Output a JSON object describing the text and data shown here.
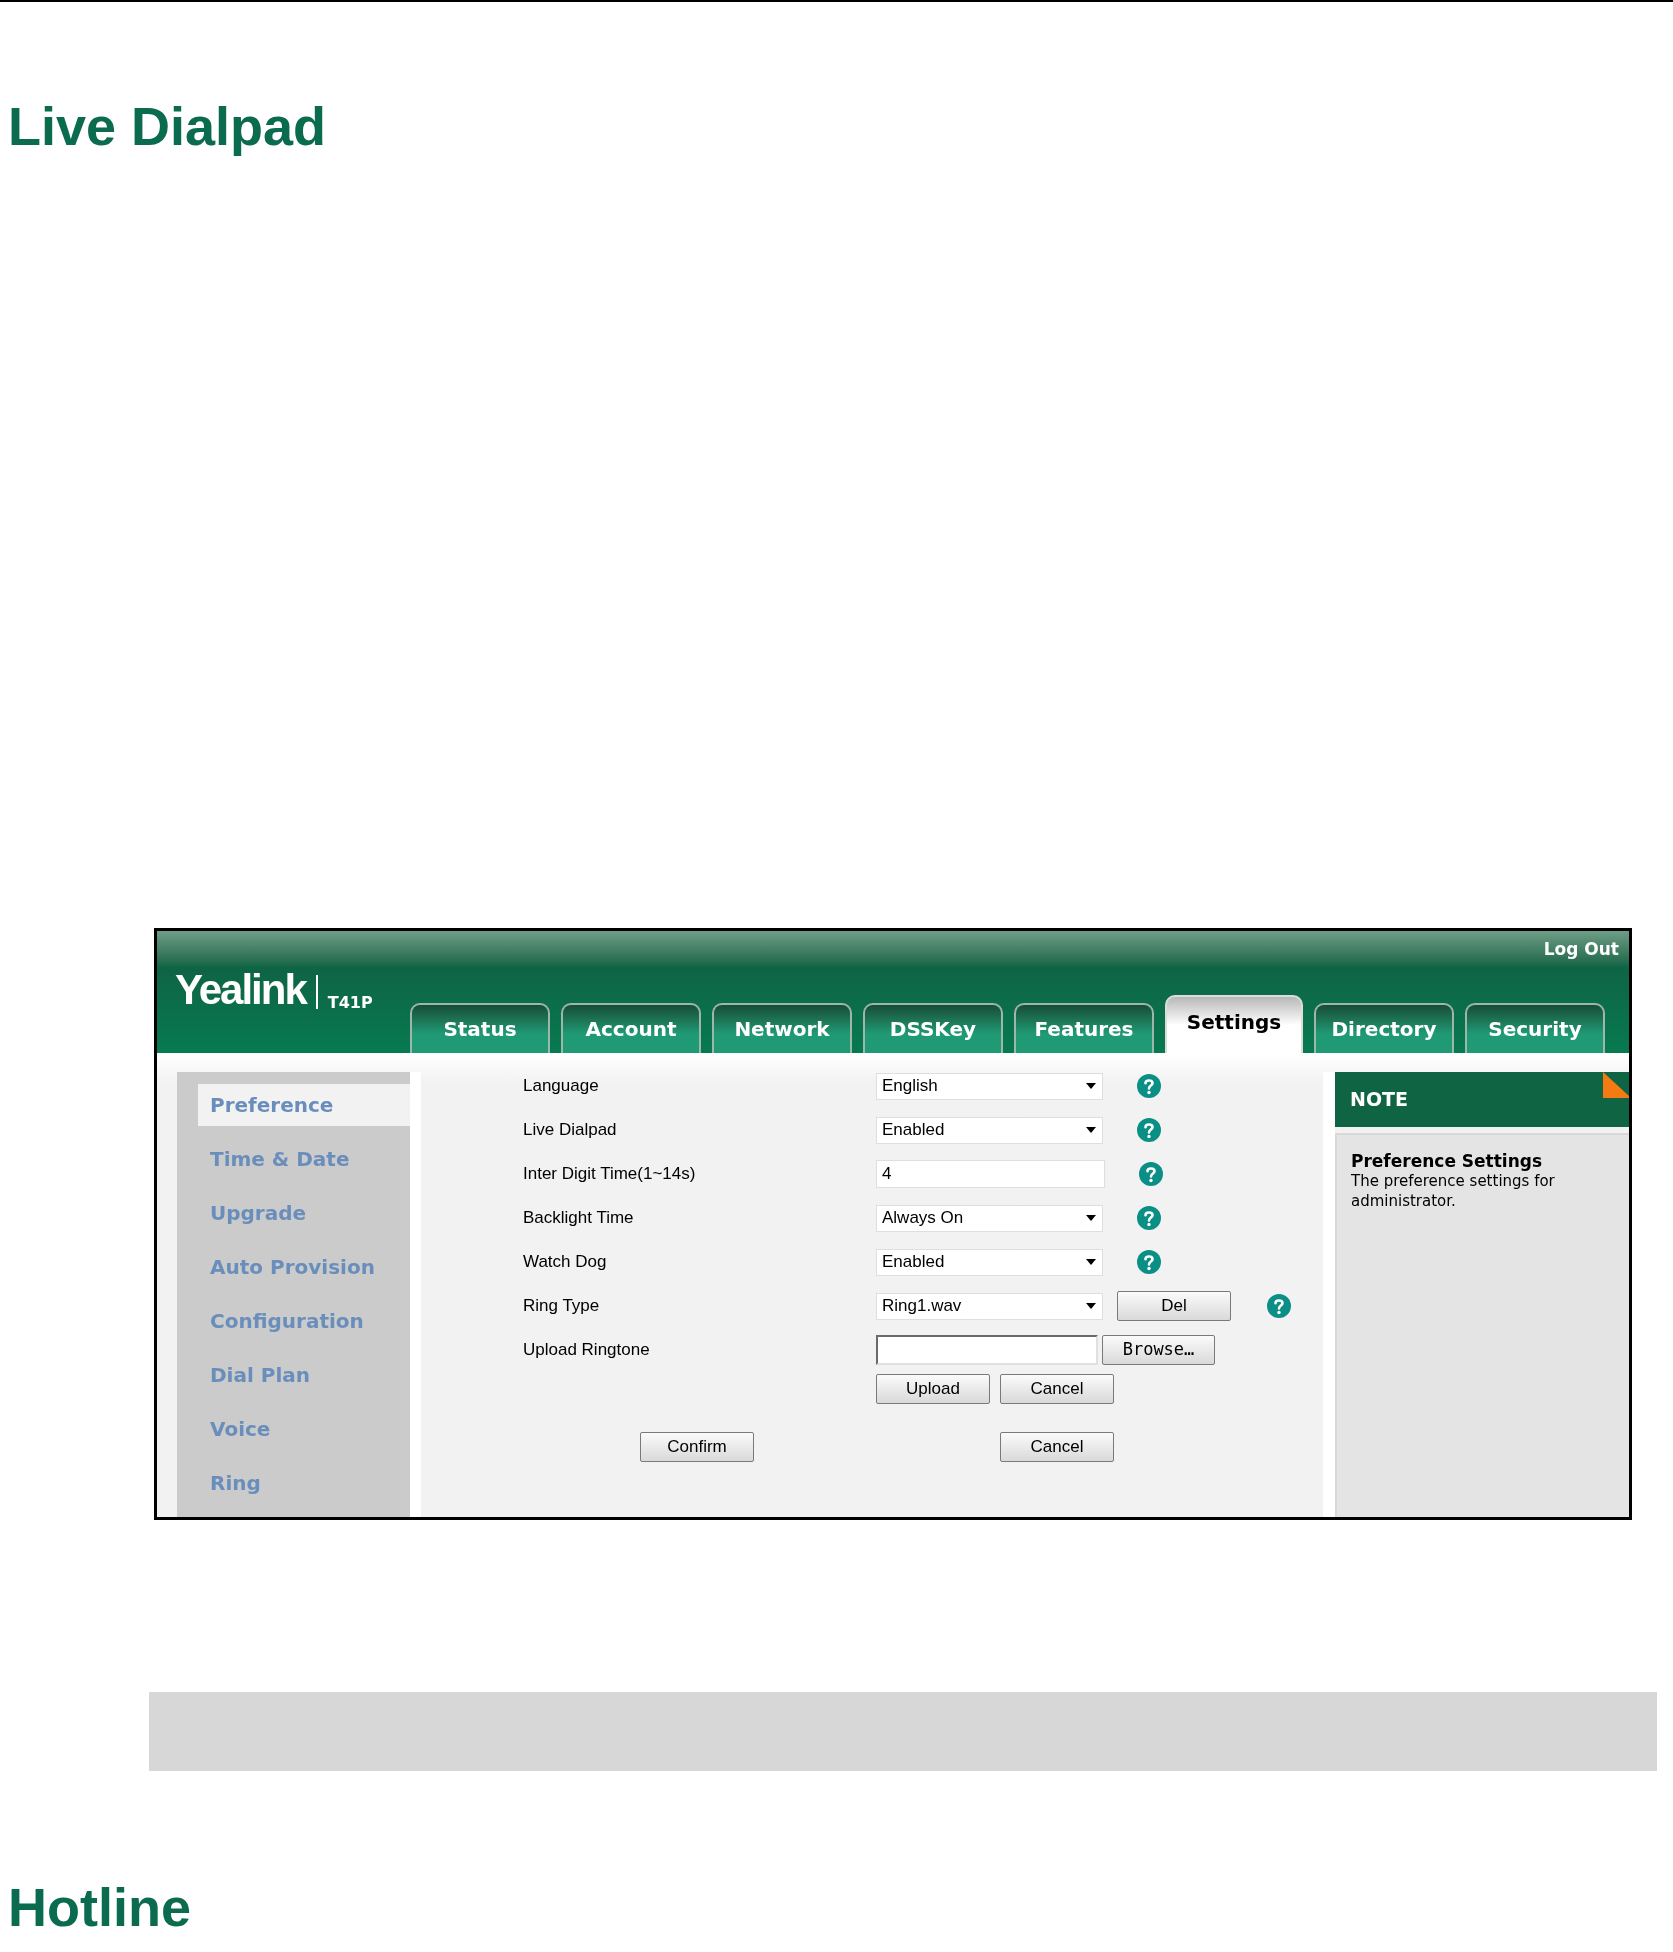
{
  "page_heading": "Live Dialpad",
  "app": {
    "logo": "Yealink",
    "model": "T41P",
    "logout": "Log Out",
    "tabs": [
      {
        "label": "Status",
        "selected": false
      },
      {
        "label": "Account",
        "selected": false
      },
      {
        "label": "Network",
        "selected": false
      },
      {
        "label": "DSSKey",
        "selected": false
      },
      {
        "label": "Features",
        "selected": false
      },
      {
        "label": "Settings",
        "selected": true
      },
      {
        "label": "Directory",
        "selected": false
      },
      {
        "label": "Security",
        "selected": false
      }
    ],
    "sidebar": [
      {
        "label": "Preference",
        "selected": true
      },
      {
        "label": "Time & Date",
        "selected": false
      },
      {
        "label": "Upgrade",
        "selected": false
      },
      {
        "label": "Auto Provision",
        "selected": false
      },
      {
        "label": "Configuration",
        "selected": false
      },
      {
        "label": "Dial Plan",
        "selected": false
      },
      {
        "label": "Voice",
        "selected": false
      },
      {
        "label": "Ring",
        "selected": false
      }
    ],
    "form": {
      "rows": [
        {
          "kind": "select",
          "label": "Language",
          "value": "English",
          "help": true
        },
        {
          "kind": "select",
          "label": "Live Dialpad",
          "value": "Enabled",
          "help": true
        },
        {
          "kind": "input",
          "label": "Inter Digit Time(1~14s)",
          "value": "4",
          "help": true
        },
        {
          "kind": "select",
          "label": "Backlight Time",
          "value": "Always On",
          "help": true
        },
        {
          "kind": "select",
          "label": "Watch Dog",
          "value": "Enabled",
          "help": true
        },
        {
          "kind": "select",
          "label": "Ring Type",
          "value": "Ring1.wav",
          "button": "Del",
          "help": true
        },
        {
          "kind": "file",
          "label": "Upload Ringtone",
          "button": "Browse…",
          "help": false
        }
      ],
      "upload_buttons": [
        "Upload",
        "Cancel"
      ],
      "buttons": [
        "Confirm",
        "Cancel"
      ]
    },
    "note": {
      "header": "NOTE",
      "title": "Preference Settings",
      "text": "The preference settings for administrator."
    }
  },
  "next_heading": "Hotline"
}
